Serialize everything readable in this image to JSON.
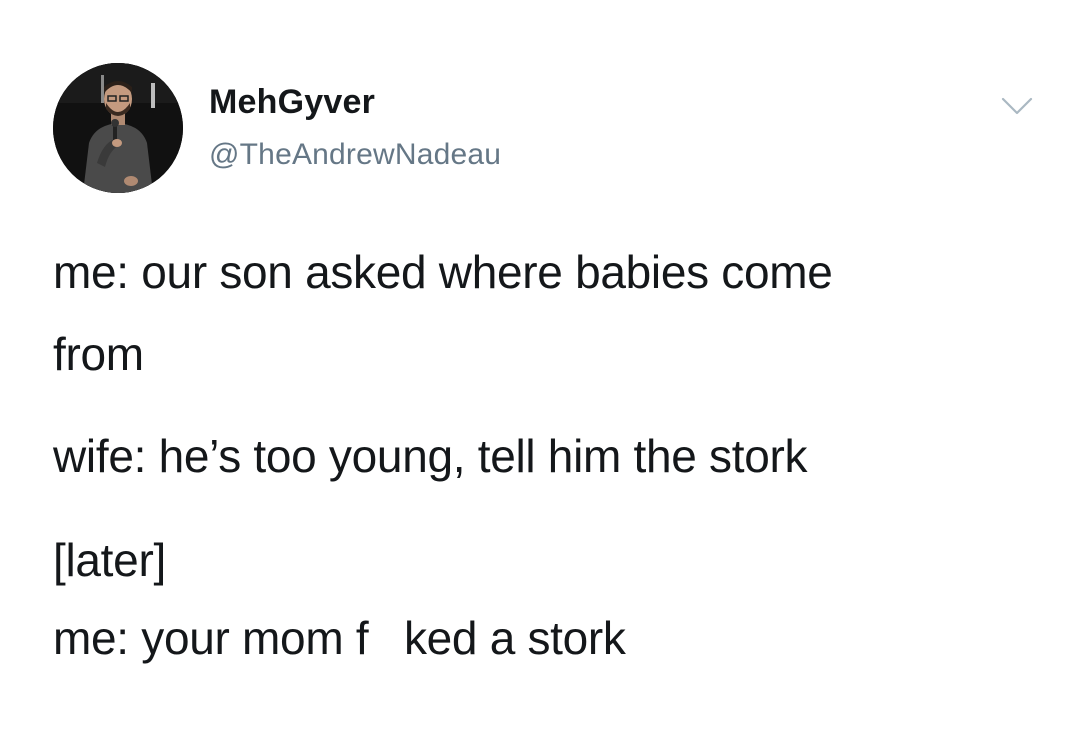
{
  "tweet": {
    "author": {
      "display_name": "MehGyver",
      "handle": "@TheAndrewNadeau",
      "avatar_icon": "profile-photo"
    },
    "menu_icon": "chevron-down-icon",
    "body_lines": [
      "me: our son asked where babies come",
      "from",
      "wife: he’s too young, tell him the stork",
      "[later]",
      "me: your mom f    ked a stork"
    ]
  }
}
